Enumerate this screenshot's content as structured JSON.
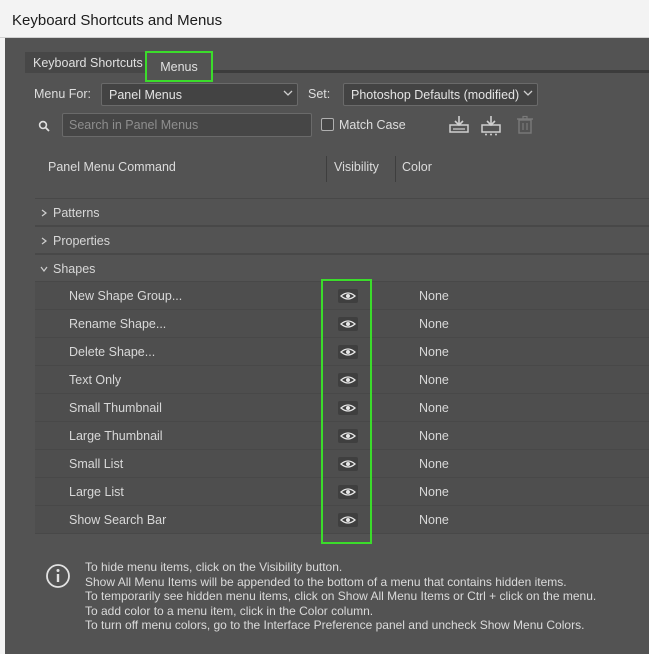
{
  "window": {
    "title": "Keyboard Shortcuts and Menus"
  },
  "tabs": {
    "shortcuts": "Keyboard Shortcuts",
    "menus": "Menus"
  },
  "menu_for": {
    "label": "Menu For:",
    "value": "Panel Menus"
  },
  "set": {
    "label": "Set:",
    "value": "Photoshop Defaults (modified)"
  },
  "search": {
    "placeholder": "Search in Panel Menus"
  },
  "match_case": {
    "label": "Match Case"
  },
  "columns": {
    "command": "Panel Menu Command",
    "visibility": "Visibility",
    "color": "Color"
  },
  "groups": [
    {
      "name": "Patterns",
      "expanded": false
    },
    {
      "name": "Properties",
      "expanded": false
    },
    {
      "name": "Shapes",
      "expanded": true
    }
  ],
  "shape_items": [
    {
      "name": "New Shape Group...",
      "color": "None"
    },
    {
      "name": "Rename Shape...",
      "color": "None"
    },
    {
      "name": "Delete Shape...",
      "color": "None"
    },
    {
      "name": "Text Only",
      "color": "None"
    },
    {
      "name": "Small Thumbnail",
      "color": "None"
    },
    {
      "name": "Large Thumbnail",
      "color": "None"
    },
    {
      "name": "Small List",
      "color": "None"
    },
    {
      "name": "Large List",
      "color": "None"
    },
    {
      "name": "Show Search Bar",
      "color": "None"
    }
  ],
  "info": {
    "lines": [
      "To hide menu items, click on the Visibility button.",
      "Show All Menu Items will be appended to the bottom of a menu that contains hidden items.",
      "To temporarily see hidden menu items, click on Show All Menu Items or Ctrl + click on the menu.",
      "To add color to a menu item, click in the Color column.",
      "To turn off menu colors, go to the Interface Preference panel and uncheck Show Menu Colors."
    ]
  },
  "colors": {
    "highlight": "#3bdc2b",
    "dialog_bg": "#535353"
  }
}
